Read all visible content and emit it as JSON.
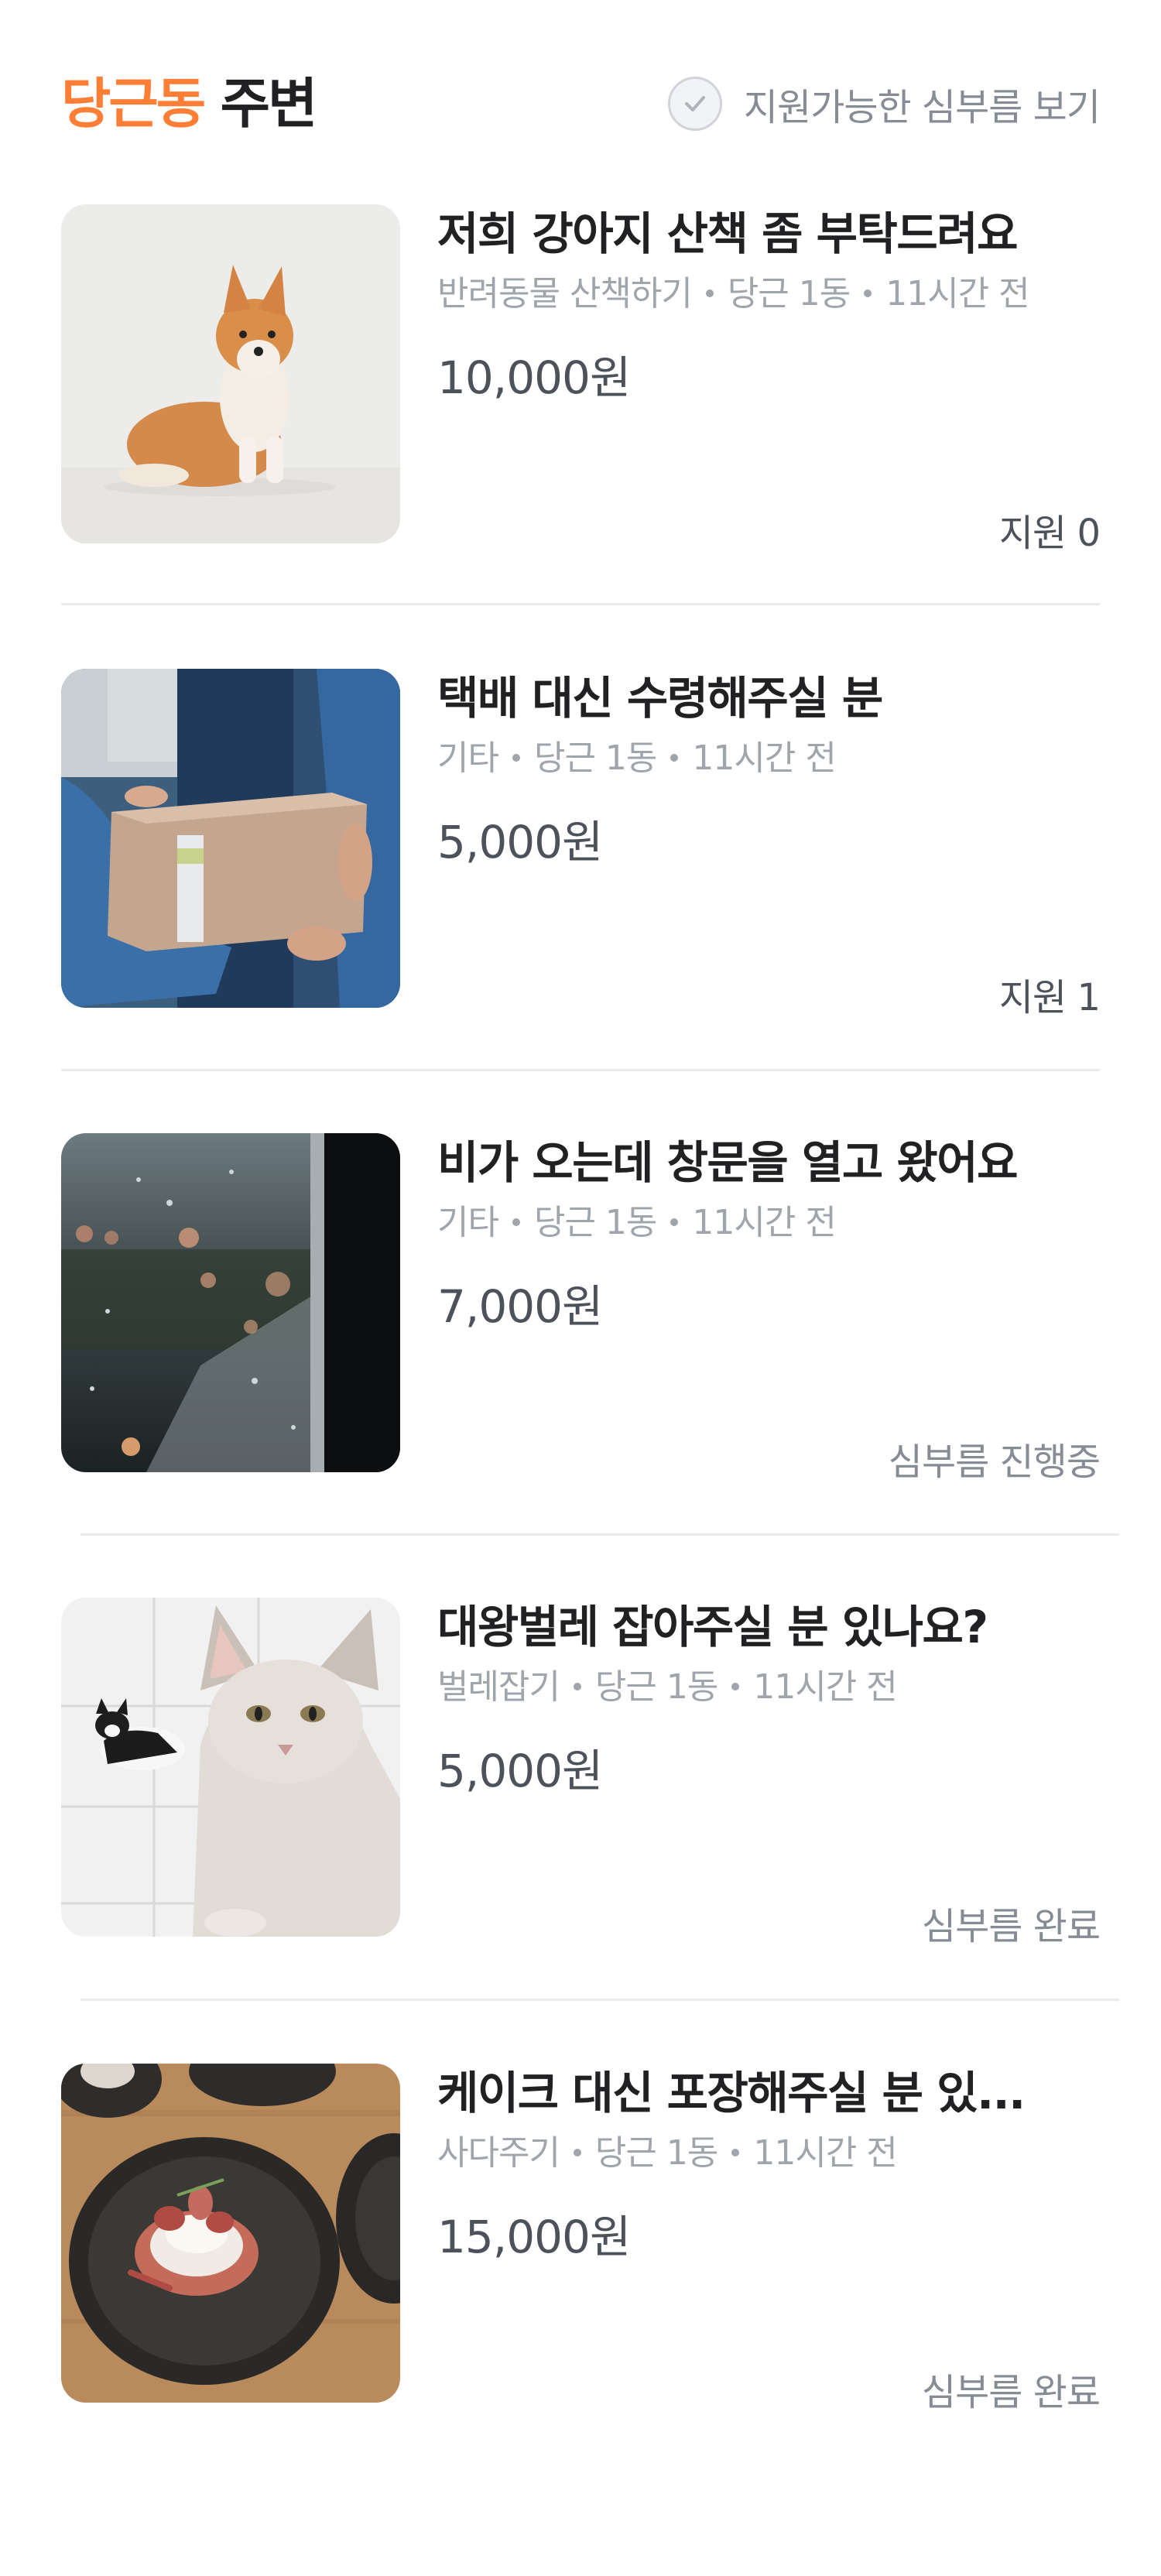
{
  "header": {
    "location": "당근동",
    "suffix": " 주변",
    "filter_label": "지원가능한 심부름 보기"
  },
  "items": [
    {
      "title": "저희 강아지 산책 좀 부탁드려요",
      "category": "반려동물 산책하기",
      "area": "당근 1동",
      "time": "11시간 전",
      "price": "10,000원",
      "status": "지원 0",
      "image": "corgi-dog-photo"
    },
    {
      "title": "택배 대신 수령해주실 분",
      "category": "기타",
      "area": "당근 1동",
      "time": "11시간 전",
      "price": "5,000원",
      "status": "지원 1",
      "image": "parcel-handover-photo"
    },
    {
      "title": "비가 오는데 창문을 열고 왔어요",
      "category": "기타",
      "area": "당근 1동",
      "time": "11시간 전",
      "price": "7,000원",
      "status": "심부름 진행중",
      "image": "rainy-window-photo"
    },
    {
      "title": "대왕벌레 잡아주실 분 있나요?",
      "category": "벌레잡기",
      "area": "당근 1동",
      "time": "11시간 전",
      "price": "5,000원",
      "status": "심부름 완료",
      "image": "cats-photo"
    },
    {
      "title": "케이크 대신 포장해주실 분 있...",
      "category": "사다주기",
      "area": "당근 1동",
      "time": "11시간 전",
      "price": "15,000원",
      "status": "심부름 완료",
      "image": "cake-plate-photo"
    }
  ]
}
